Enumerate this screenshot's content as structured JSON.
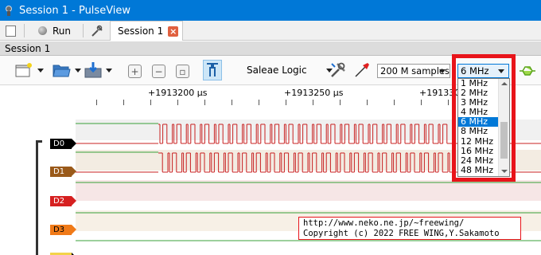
{
  "window": {
    "title": "Session 1 - PulseView"
  },
  "main_toolbar": {
    "run_label": "Run",
    "tab_label": "Session 1"
  },
  "session": {
    "label": "Session 1"
  },
  "toolbar": {
    "device": "Saleae Logic",
    "samples": "200 M samples",
    "sample_rate": "6 MHz",
    "colors": {
      "cursor_active": "#cde6f7",
      "probe_red": "#e02020",
      "probe_green": "#6cc020"
    }
  },
  "ruler": {
    "labels": [
      "+1913200 µs",
      "+1913250 µs",
      "+191330"
    ]
  },
  "channels": [
    {
      "name": "D0",
      "color": "#000000",
      "text_color": "#ffffff",
      "lane_color": "#f0f0f0"
    },
    {
      "name": "D1",
      "color": "#9a5a1a",
      "text_color": "#ffffff",
      "lane_color": "#f3ece2"
    },
    {
      "name": "D2",
      "color": "#d62020",
      "text_color": "#ffffff",
      "lane_color": "#f6e6e6"
    },
    {
      "name": "D3",
      "color": "#f07a18",
      "text_color": "#000000",
      "lane_color": "#f7f0e6"
    }
  ],
  "rate_dropdown": {
    "options": [
      "1 MHz",
      "2 MHz",
      "3 MHz",
      "4 MHz",
      "6 MHz",
      "8 MHz",
      "12 MHz",
      "16 MHz",
      "24 MHz",
      "48 MHz"
    ],
    "selected": "6 MHz"
  },
  "overlay": {
    "url": "http://www.neko.ne.jp/~freewing/",
    "copyright": "Copyright (c) 2022 FREE WING,Y.Sakamoto"
  }
}
